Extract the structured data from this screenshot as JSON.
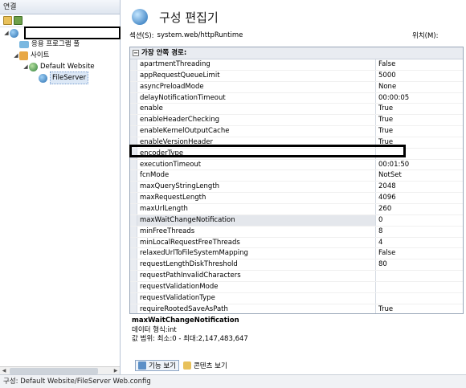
{
  "left_panel": {
    "header": "연결",
    "tree": [
      {
        "label": "",
        "icon": "server-icon",
        "expander": "◢",
        "indent": 0
      },
      {
        "label": "응용 프로그램 풀",
        "icon": "app-pools-icon",
        "expander": "",
        "indent": 1
      },
      {
        "label": "사이트",
        "icon": "sites-icon",
        "expander": "◢",
        "indent": 1
      },
      {
        "label": "Default Website",
        "icon": "website-icon",
        "expander": "◢",
        "indent": 2
      },
      {
        "label": "FileServer",
        "icon": "folder-icon",
        "expander": "",
        "indent": 3,
        "selected": true
      }
    ]
  },
  "editor": {
    "title": "구성 편집기",
    "section_label": "섹션(S):",
    "section_value": "system.web/httpRuntime",
    "location_label": "위치(M):",
    "group_header": "가장 안쪽 경로:",
    "properties": [
      {
        "name": "apartmentThreading",
        "value": "False"
      },
      {
        "name": "appRequestQueueLimit",
        "value": "5000"
      },
      {
        "name": "asyncPreloadMode",
        "value": "None"
      },
      {
        "name": "delayNotificationTimeout",
        "value": "00:00:05"
      },
      {
        "name": "enable",
        "value": "True"
      },
      {
        "name": "enableHeaderChecking",
        "value": "True"
      },
      {
        "name": "enableKernelOutputCache",
        "value": "True"
      },
      {
        "name": "enableVersionHeader",
        "value": "True"
      },
      {
        "name": "encoderType",
        "value": ""
      },
      {
        "name": "executionTimeout",
        "value": "00:01:50"
      },
      {
        "name": "fcnMode",
        "value": "NotSet"
      },
      {
        "name": "maxQueryStringLength",
        "value": "2048"
      },
      {
        "name": "maxRequestLength",
        "value": "4096"
      },
      {
        "name": "maxUrlLength",
        "value": "260"
      },
      {
        "name": "maxWaitChangeNotification",
        "value": "0",
        "selected": true
      },
      {
        "name": "minFreeThreads",
        "value": "8"
      },
      {
        "name": "minLocalRequestFreeThreads",
        "value": "4"
      },
      {
        "name": "relaxedUrlToFileSystemMapping",
        "value": "False"
      },
      {
        "name": "requestLengthDiskThreshold",
        "value": "80"
      },
      {
        "name": "requestPathInvalidCharacters",
        "value": ""
      },
      {
        "name": "requestValidationMode",
        "value": ""
      },
      {
        "name": "requestValidationType",
        "value": ""
      },
      {
        "name": "requireRootedSaveAsPath",
        "value": "True"
      }
    ],
    "description": {
      "title": "maxWaitChangeNotification",
      "lines": [
        "데이터 형식:int",
        "값 범위: 최소:0 - 최대:2,147,483,647"
      ]
    }
  },
  "view_tabs": [
    {
      "label": "기능 보기",
      "icon": "features-view-icon",
      "active": true
    },
    {
      "label": "콘텐츠 보기",
      "icon": "content-view-icon",
      "active": false
    }
  ],
  "status_bar": {
    "text": "구성: Default Website/FileServer Web.config"
  }
}
